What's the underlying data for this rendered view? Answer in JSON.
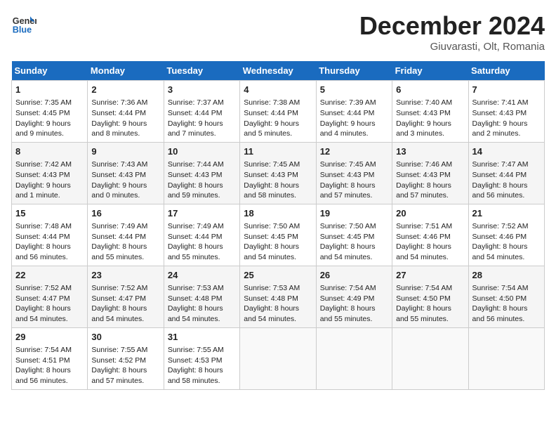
{
  "header": {
    "logo_general": "General",
    "logo_blue": "Blue",
    "main_title": "December 2024",
    "subtitle": "Giuvarasti, Olt, Romania"
  },
  "calendar": {
    "days_of_week": [
      "Sunday",
      "Monday",
      "Tuesday",
      "Wednesday",
      "Thursday",
      "Friday",
      "Saturday"
    ],
    "weeks": [
      [
        {
          "day": "1",
          "sunrise": "Sunrise: 7:35 AM",
          "sunset": "Sunset: 4:45 PM",
          "daylight": "Daylight: 9 hours and 9 minutes."
        },
        {
          "day": "2",
          "sunrise": "Sunrise: 7:36 AM",
          "sunset": "Sunset: 4:44 PM",
          "daylight": "Daylight: 9 hours and 8 minutes."
        },
        {
          "day": "3",
          "sunrise": "Sunrise: 7:37 AM",
          "sunset": "Sunset: 4:44 PM",
          "daylight": "Daylight: 9 hours and 7 minutes."
        },
        {
          "day": "4",
          "sunrise": "Sunrise: 7:38 AM",
          "sunset": "Sunset: 4:44 PM",
          "daylight": "Daylight: 9 hours and 5 minutes."
        },
        {
          "day": "5",
          "sunrise": "Sunrise: 7:39 AM",
          "sunset": "Sunset: 4:44 PM",
          "daylight": "Daylight: 9 hours and 4 minutes."
        },
        {
          "day": "6",
          "sunrise": "Sunrise: 7:40 AM",
          "sunset": "Sunset: 4:43 PM",
          "daylight": "Daylight: 9 hours and 3 minutes."
        },
        {
          "day": "7",
          "sunrise": "Sunrise: 7:41 AM",
          "sunset": "Sunset: 4:43 PM",
          "daylight": "Daylight: 9 hours and 2 minutes."
        }
      ],
      [
        {
          "day": "8",
          "sunrise": "Sunrise: 7:42 AM",
          "sunset": "Sunset: 4:43 PM",
          "daylight": "Daylight: 9 hours and 1 minute."
        },
        {
          "day": "9",
          "sunrise": "Sunrise: 7:43 AM",
          "sunset": "Sunset: 4:43 PM",
          "daylight": "Daylight: 9 hours and 0 minutes."
        },
        {
          "day": "10",
          "sunrise": "Sunrise: 7:44 AM",
          "sunset": "Sunset: 4:43 PM",
          "daylight": "Daylight: 8 hours and 59 minutes."
        },
        {
          "day": "11",
          "sunrise": "Sunrise: 7:45 AM",
          "sunset": "Sunset: 4:43 PM",
          "daylight": "Daylight: 8 hours and 58 minutes."
        },
        {
          "day": "12",
          "sunrise": "Sunrise: 7:45 AM",
          "sunset": "Sunset: 4:43 PM",
          "daylight": "Daylight: 8 hours and 57 minutes."
        },
        {
          "day": "13",
          "sunrise": "Sunrise: 7:46 AM",
          "sunset": "Sunset: 4:43 PM",
          "daylight": "Daylight: 8 hours and 57 minutes."
        },
        {
          "day": "14",
          "sunrise": "Sunrise: 7:47 AM",
          "sunset": "Sunset: 4:44 PM",
          "daylight": "Daylight: 8 hours and 56 minutes."
        }
      ],
      [
        {
          "day": "15",
          "sunrise": "Sunrise: 7:48 AM",
          "sunset": "Sunset: 4:44 PM",
          "daylight": "Daylight: 8 hours and 56 minutes."
        },
        {
          "day": "16",
          "sunrise": "Sunrise: 7:49 AM",
          "sunset": "Sunset: 4:44 PM",
          "daylight": "Daylight: 8 hours and 55 minutes."
        },
        {
          "day": "17",
          "sunrise": "Sunrise: 7:49 AM",
          "sunset": "Sunset: 4:44 PM",
          "daylight": "Daylight: 8 hours and 55 minutes."
        },
        {
          "day": "18",
          "sunrise": "Sunrise: 7:50 AM",
          "sunset": "Sunset: 4:45 PM",
          "daylight": "Daylight: 8 hours and 54 minutes."
        },
        {
          "day": "19",
          "sunrise": "Sunrise: 7:50 AM",
          "sunset": "Sunset: 4:45 PM",
          "daylight": "Daylight: 8 hours and 54 minutes."
        },
        {
          "day": "20",
          "sunrise": "Sunrise: 7:51 AM",
          "sunset": "Sunset: 4:46 PM",
          "daylight": "Daylight: 8 hours and 54 minutes."
        },
        {
          "day": "21",
          "sunrise": "Sunrise: 7:52 AM",
          "sunset": "Sunset: 4:46 PM",
          "daylight": "Daylight: 8 hours and 54 minutes."
        }
      ],
      [
        {
          "day": "22",
          "sunrise": "Sunrise: 7:52 AM",
          "sunset": "Sunset: 4:47 PM",
          "daylight": "Daylight: 8 hours and 54 minutes."
        },
        {
          "day": "23",
          "sunrise": "Sunrise: 7:52 AM",
          "sunset": "Sunset: 4:47 PM",
          "daylight": "Daylight: 8 hours and 54 minutes."
        },
        {
          "day": "24",
          "sunrise": "Sunrise: 7:53 AM",
          "sunset": "Sunset: 4:48 PM",
          "daylight": "Daylight: 8 hours and 54 minutes."
        },
        {
          "day": "25",
          "sunrise": "Sunrise: 7:53 AM",
          "sunset": "Sunset: 4:48 PM",
          "daylight": "Daylight: 8 hours and 54 minutes."
        },
        {
          "day": "26",
          "sunrise": "Sunrise: 7:54 AM",
          "sunset": "Sunset: 4:49 PM",
          "daylight": "Daylight: 8 hours and 55 minutes."
        },
        {
          "day": "27",
          "sunrise": "Sunrise: 7:54 AM",
          "sunset": "Sunset: 4:50 PM",
          "daylight": "Daylight: 8 hours and 55 minutes."
        },
        {
          "day": "28",
          "sunrise": "Sunrise: 7:54 AM",
          "sunset": "Sunset: 4:50 PM",
          "daylight": "Daylight: 8 hours and 56 minutes."
        }
      ],
      [
        {
          "day": "29",
          "sunrise": "Sunrise: 7:54 AM",
          "sunset": "Sunset: 4:51 PM",
          "daylight": "Daylight: 8 hours and 56 minutes."
        },
        {
          "day": "30",
          "sunrise": "Sunrise: 7:55 AM",
          "sunset": "Sunset: 4:52 PM",
          "daylight": "Daylight: 8 hours and 57 minutes."
        },
        {
          "day": "31",
          "sunrise": "Sunrise: 7:55 AM",
          "sunset": "Sunset: 4:53 PM",
          "daylight": "Daylight: 8 hours and 58 minutes."
        },
        null,
        null,
        null,
        null
      ]
    ]
  }
}
